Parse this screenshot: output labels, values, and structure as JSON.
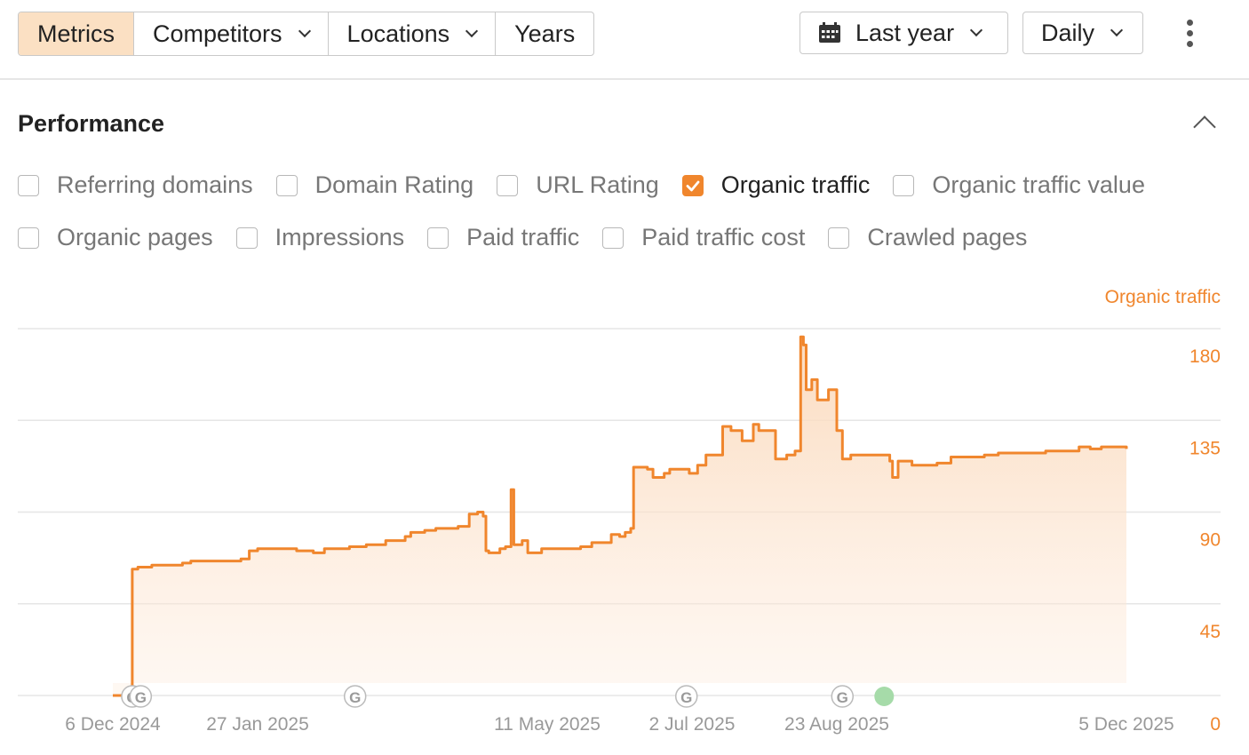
{
  "toolbar": {
    "segments": [
      "Metrics",
      "Competitors",
      "Locations",
      "Years"
    ],
    "period": "Last year",
    "granularity": "Daily"
  },
  "performance": {
    "title": "Performance",
    "metrics_row1": [
      {
        "label": "Referring domains",
        "checked": false
      },
      {
        "label": "Domain Rating",
        "checked": false
      },
      {
        "label": "URL Rating",
        "checked": false
      },
      {
        "label": "Organic traffic",
        "checked": true
      },
      {
        "label": "Organic traffic value",
        "checked": false
      }
    ],
    "metrics_row2": [
      {
        "label": "Organic pages",
        "checked": false
      },
      {
        "label": "Impressions",
        "checked": false
      },
      {
        "label": "Paid traffic",
        "checked": false
      },
      {
        "label": "Paid traffic cost",
        "checked": false
      },
      {
        "label": "Crawled pages",
        "checked": false
      }
    ]
  },
  "colors": {
    "accent": "#f0862d",
    "active_segment": "#fbe0c3",
    "marker_green": "#a6dba9"
  },
  "chart_data": {
    "type": "area",
    "series": [
      {
        "name": "Organic traffic",
        "points": [
          [
            "2024-12-06",
            0
          ],
          [
            "2024-12-12",
            0
          ],
          [
            "2024-12-13",
            62
          ],
          [
            "2024-12-15",
            63
          ],
          [
            "2024-12-20",
            64
          ],
          [
            "2024-12-31",
            65
          ],
          [
            "2025-01-03",
            66
          ],
          [
            "2025-01-21",
            67
          ],
          [
            "2025-01-24",
            71
          ],
          [
            "2025-01-27",
            72
          ],
          [
            "2025-02-10",
            71
          ],
          [
            "2025-02-13",
            71
          ],
          [
            "2025-02-16",
            70
          ],
          [
            "2025-02-20",
            72
          ],
          [
            "2025-03-01",
            73
          ],
          [
            "2025-03-07",
            74
          ],
          [
            "2025-03-11",
            74
          ],
          [
            "2025-03-14",
            76
          ],
          [
            "2025-03-18",
            76
          ],
          [
            "2025-03-21",
            78
          ],
          [
            "2025-03-23",
            80
          ],
          [
            "2025-03-28",
            81
          ],
          [
            "2025-04-01",
            82
          ],
          [
            "2025-04-09",
            83
          ],
          [
            "2025-04-13",
            89
          ],
          [
            "2025-04-16",
            90
          ],
          [
            "2025-04-18",
            88
          ],
          [
            "2025-04-19",
            71
          ],
          [
            "2025-04-20",
            70
          ],
          [
            "2025-04-24",
            72
          ],
          [
            "2025-04-26",
            73
          ],
          [
            "2025-04-28",
            101
          ],
          [
            "2025-04-29",
            74
          ],
          [
            "2025-05-02",
            76
          ],
          [
            "2025-05-04",
            70
          ],
          [
            "2025-05-08",
            70
          ],
          [
            "2025-05-09",
            72
          ],
          [
            "2025-05-16",
            72
          ],
          [
            "2025-05-23",
            73
          ],
          [
            "2025-05-27",
            75
          ],
          [
            "2025-06-03",
            79
          ],
          [
            "2025-06-06",
            78
          ],
          [
            "2025-06-08",
            80
          ],
          [
            "2025-06-10",
            82
          ],
          [
            "2025-06-11",
            112
          ],
          [
            "2025-06-16",
            111
          ],
          [
            "2025-06-18",
            107
          ],
          [
            "2025-06-22",
            109
          ],
          [
            "2025-06-24",
            111
          ],
          [
            "2025-07-01",
            109
          ],
          [
            "2025-07-04",
            113
          ],
          [
            "2025-07-07",
            118
          ],
          [
            "2025-07-13",
            132
          ],
          [
            "2025-07-16",
            130
          ],
          [
            "2025-07-20",
            125
          ],
          [
            "2025-07-24",
            133
          ],
          [
            "2025-07-26",
            130
          ],
          [
            "2025-07-28",
            130
          ],
          [
            "2025-08-01",
            116
          ],
          [
            "2025-08-05",
            118
          ],
          [
            "2025-08-08",
            120
          ],
          [
            "2025-08-10",
            176
          ],
          [
            "2025-08-11",
            172
          ],
          [
            "2025-08-12",
            150
          ],
          [
            "2025-08-14",
            155
          ],
          [
            "2025-08-16",
            145
          ],
          [
            "2025-08-20",
            150
          ],
          [
            "2025-08-23",
            130
          ],
          [
            "2025-08-25",
            116
          ],
          [
            "2025-08-28",
            118
          ],
          [
            "2025-09-03",
            118
          ],
          [
            "2025-09-11",
            115
          ],
          [
            "2025-09-12",
            107
          ],
          [
            "2025-09-14",
            115
          ],
          [
            "2025-09-19",
            113
          ],
          [
            "2025-09-25",
            113
          ],
          [
            "2025-09-28",
            114
          ],
          [
            "2025-10-03",
            117
          ],
          [
            "2025-10-08",
            117
          ],
          [
            "2025-10-15",
            118
          ],
          [
            "2025-10-20",
            119
          ],
          [
            "2025-11-06",
            120
          ],
          [
            "2025-11-18",
            122
          ],
          [
            "2025-11-22",
            121
          ],
          [
            "2025-11-26",
            122
          ],
          [
            "2025-12-05",
            121
          ]
        ]
      }
    ],
    "y_ticks": [
      "180",
      "135",
      "90",
      "45",
      "0"
    ],
    "y_label": "Organic traffic",
    "ylim": [
      0,
      180
    ],
    "x_ticks": [
      "6 Dec 2024",
      "27 Jan 2025",
      "11 May 2025",
      "2 Jul 2025",
      "23 Aug 2025",
      "5 Dec 2025"
    ],
    "x_tick_dates": [
      "2024-12-06",
      "2025-01-27",
      "2025-05-11",
      "2025-07-02",
      "2025-08-23",
      "2025-12-05"
    ],
    "annotations": [
      {
        "label": "G",
        "date": "2024-12-13"
      },
      {
        "label": "G",
        "date": "2024-12-16"
      },
      {
        "label": "G",
        "date": "2025-03-03"
      },
      {
        "label": "G",
        "date": "2025-06-30"
      },
      {
        "label": "G",
        "date": "2025-08-25"
      },
      {
        "label": "",
        "date": "2025-09-09",
        "kind": "green"
      }
    ],
    "grid": true
  }
}
